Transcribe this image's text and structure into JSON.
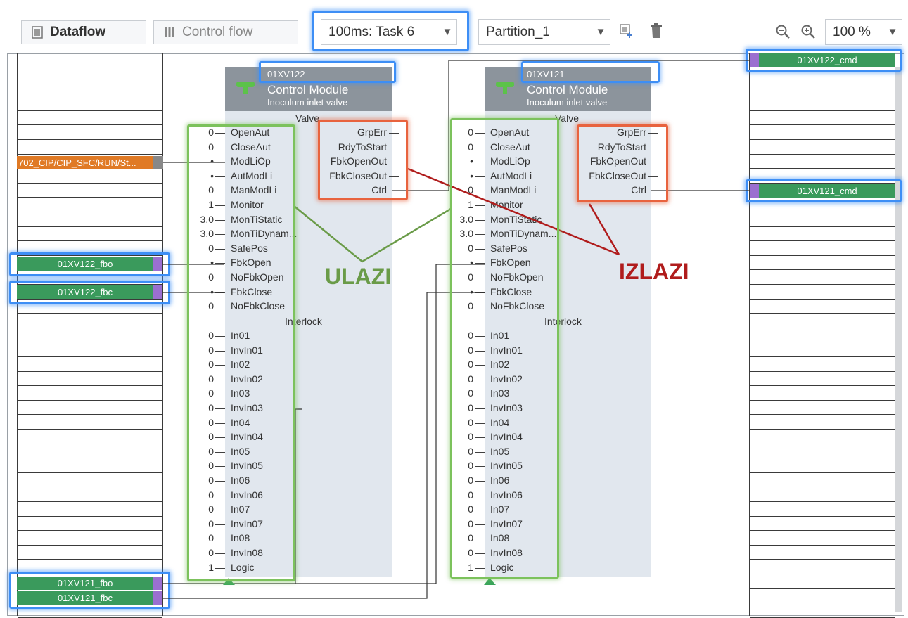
{
  "toolbar": {
    "dataflow_label": "Dataflow",
    "controlflow_label": "Control flow",
    "task_select": "100ms: Task 6",
    "partition_select": "Partition_1",
    "zoom_value": "100 %"
  },
  "left_signals": {
    "orange": "702_CIP/CIP_SFC/RUN/St...",
    "fbo122": "01XV122_fbo",
    "fbc122": "01XV122_fbc",
    "fbo121": "01XV121_fbo",
    "fbc121": "01XV121_fbc"
  },
  "right_signals": {
    "cmd122": "01XV122_cmd",
    "cmd121": "01XV121_cmd"
  },
  "block1": {
    "name": "01XV122",
    "type": "Control Module",
    "desc": "Inoculum inlet valve",
    "section_valve": "Valve",
    "section_interlock": "Interlock"
  },
  "block2": {
    "name": "01XV121",
    "type": "Control Module",
    "desc": "Inoculum inlet valve",
    "section_valve": "Valve",
    "section_interlock": "Interlock"
  },
  "inputs": [
    {
      "name": "OpenAut",
      "val": "0"
    },
    {
      "name": "CloseAut",
      "val": "0"
    },
    {
      "name": "ModLiOp",
      "val": "•"
    },
    {
      "name": "AutModLi",
      "val": "•"
    },
    {
      "name": "ManModLi",
      "val": "0"
    },
    {
      "name": "Monitor",
      "val": "1"
    },
    {
      "name": "MonTiStatic",
      "val": "3.0"
    },
    {
      "name": "MonTiDynam...",
      "val": "3.0"
    },
    {
      "name": "SafePos",
      "val": "0"
    },
    {
      "name": "FbkOpen",
      "val": "•"
    },
    {
      "name": "NoFbkOpen",
      "val": "0"
    },
    {
      "name": "FbkClose",
      "val": "•"
    },
    {
      "name": "NoFbkClose",
      "val": "0"
    }
  ],
  "interlock_inputs": [
    {
      "name": "In01",
      "val": "0"
    },
    {
      "name": "InvIn01",
      "val": "0"
    },
    {
      "name": "In02",
      "val": "0"
    },
    {
      "name": "InvIn02",
      "val": "0"
    },
    {
      "name": "In03",
      "val": "0"
    },
    {
      "name": "InvIn03",
      "val": "0"
    },
    {
      "name": "In04",
      "val": "0"
    },
    {
      "name": "InvIn04",
      "val": "0"
    },
    {
      "name": "In05",
      "val": "0"
    },
    {
      "name": "InvIn05",
      "val": "0"
    },
    {
      "name": "In06",
      "val": "0"
    },
    {
      "name": "InvIn06",
      "val": "0"
    },
    {
      "name": "In07",
      "val": "0"
    },
    {
      "name": "InvIn07",
      "val": "0"
    },
    {
      "name": "In08",
      "val": "0"
    },
    {
      "name": "InvIn08",
      "val": "0"
    },
    {
      "name": "Logic",
      "val": "1"
    }
  ],
  "outputs": [
    "GrpErr",
    "RdyToStart",
    "FbkOpenOut",
    "FbkCloseOut",
    "Ctrl"
  ],
  "annotations": {
    "inputs_label": "ULAZI",
    "outputs_label": "IZLAZI"
  },
  "colors": {
    "signal_green": "#3a9a5c",
    "signal_orange": "#e07a25",
    "highlight_blue": "#3d8ef5",
    "highlight_green": "#7cc25c",
    "highlight_red": "#e8633e",
    "label_green": "#6a9b48",
    "label_red": "#b01c1c"
  }
}
